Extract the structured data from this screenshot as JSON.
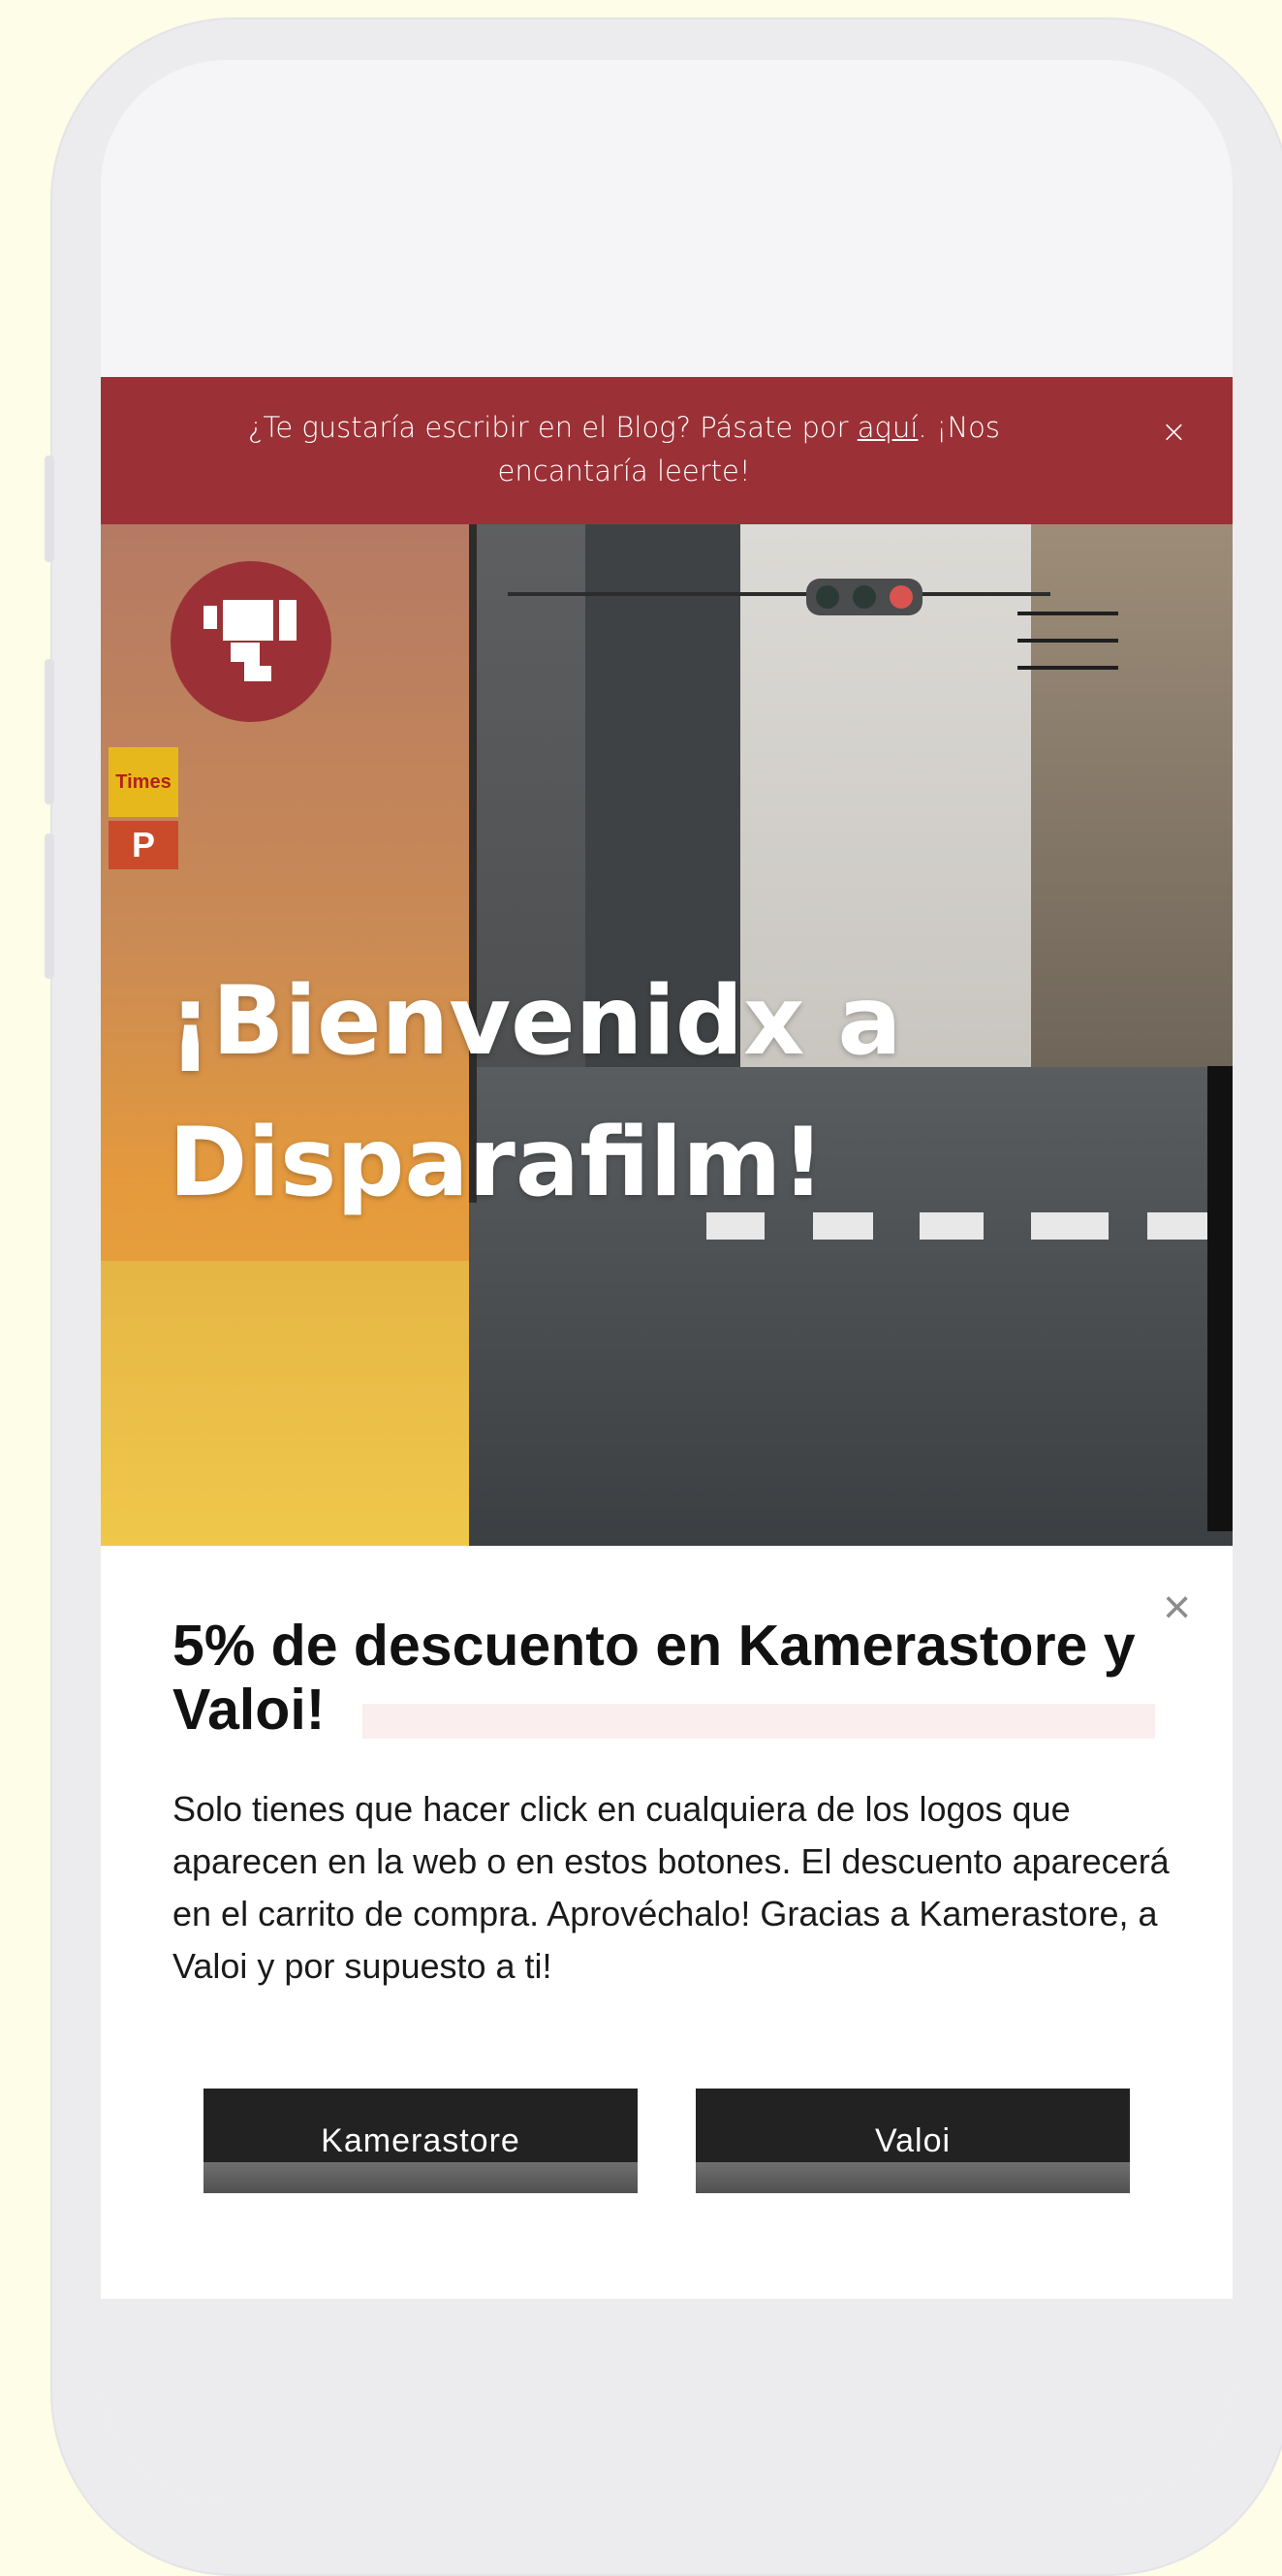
{
  "announcement": {
    "text_before": "¿Te gustaría escribir en el Blog? Pásate por",
    "link": "aquí",
    "text_after": ". ¡Nos encantaría leerte!",
    "close": "×"
  },
  "hero": {
    "title": "¡Bienvenidx a Disparafilm!",
    "sign_text": "Times",
    "parking_text": "P"
  },
  "popup": {
    "close": "×",
    "title": "5% de descuento en Kamerastore y Valoi!",
    "body": "Solo tienes que hacer click en cualquiera de los logos que aparecen en la web o en estos botones. El descuento aparecerá en el carrito de compra. Aprovéchalo! Gracias a Kamerastore, a Valoi y por supuesto a ti!",
    "buttons": [
      "Kamerastore",
      "Valoi"
    ]
  },
  "colors": {
    "brand": "#9b3136",
    "button": "#222222",
    "background": "#fdfde8"
  },
  "icons": {
    "logo": "camera-logo-icon",
    "menu": "hamburger-menu-icon"
  }
}
